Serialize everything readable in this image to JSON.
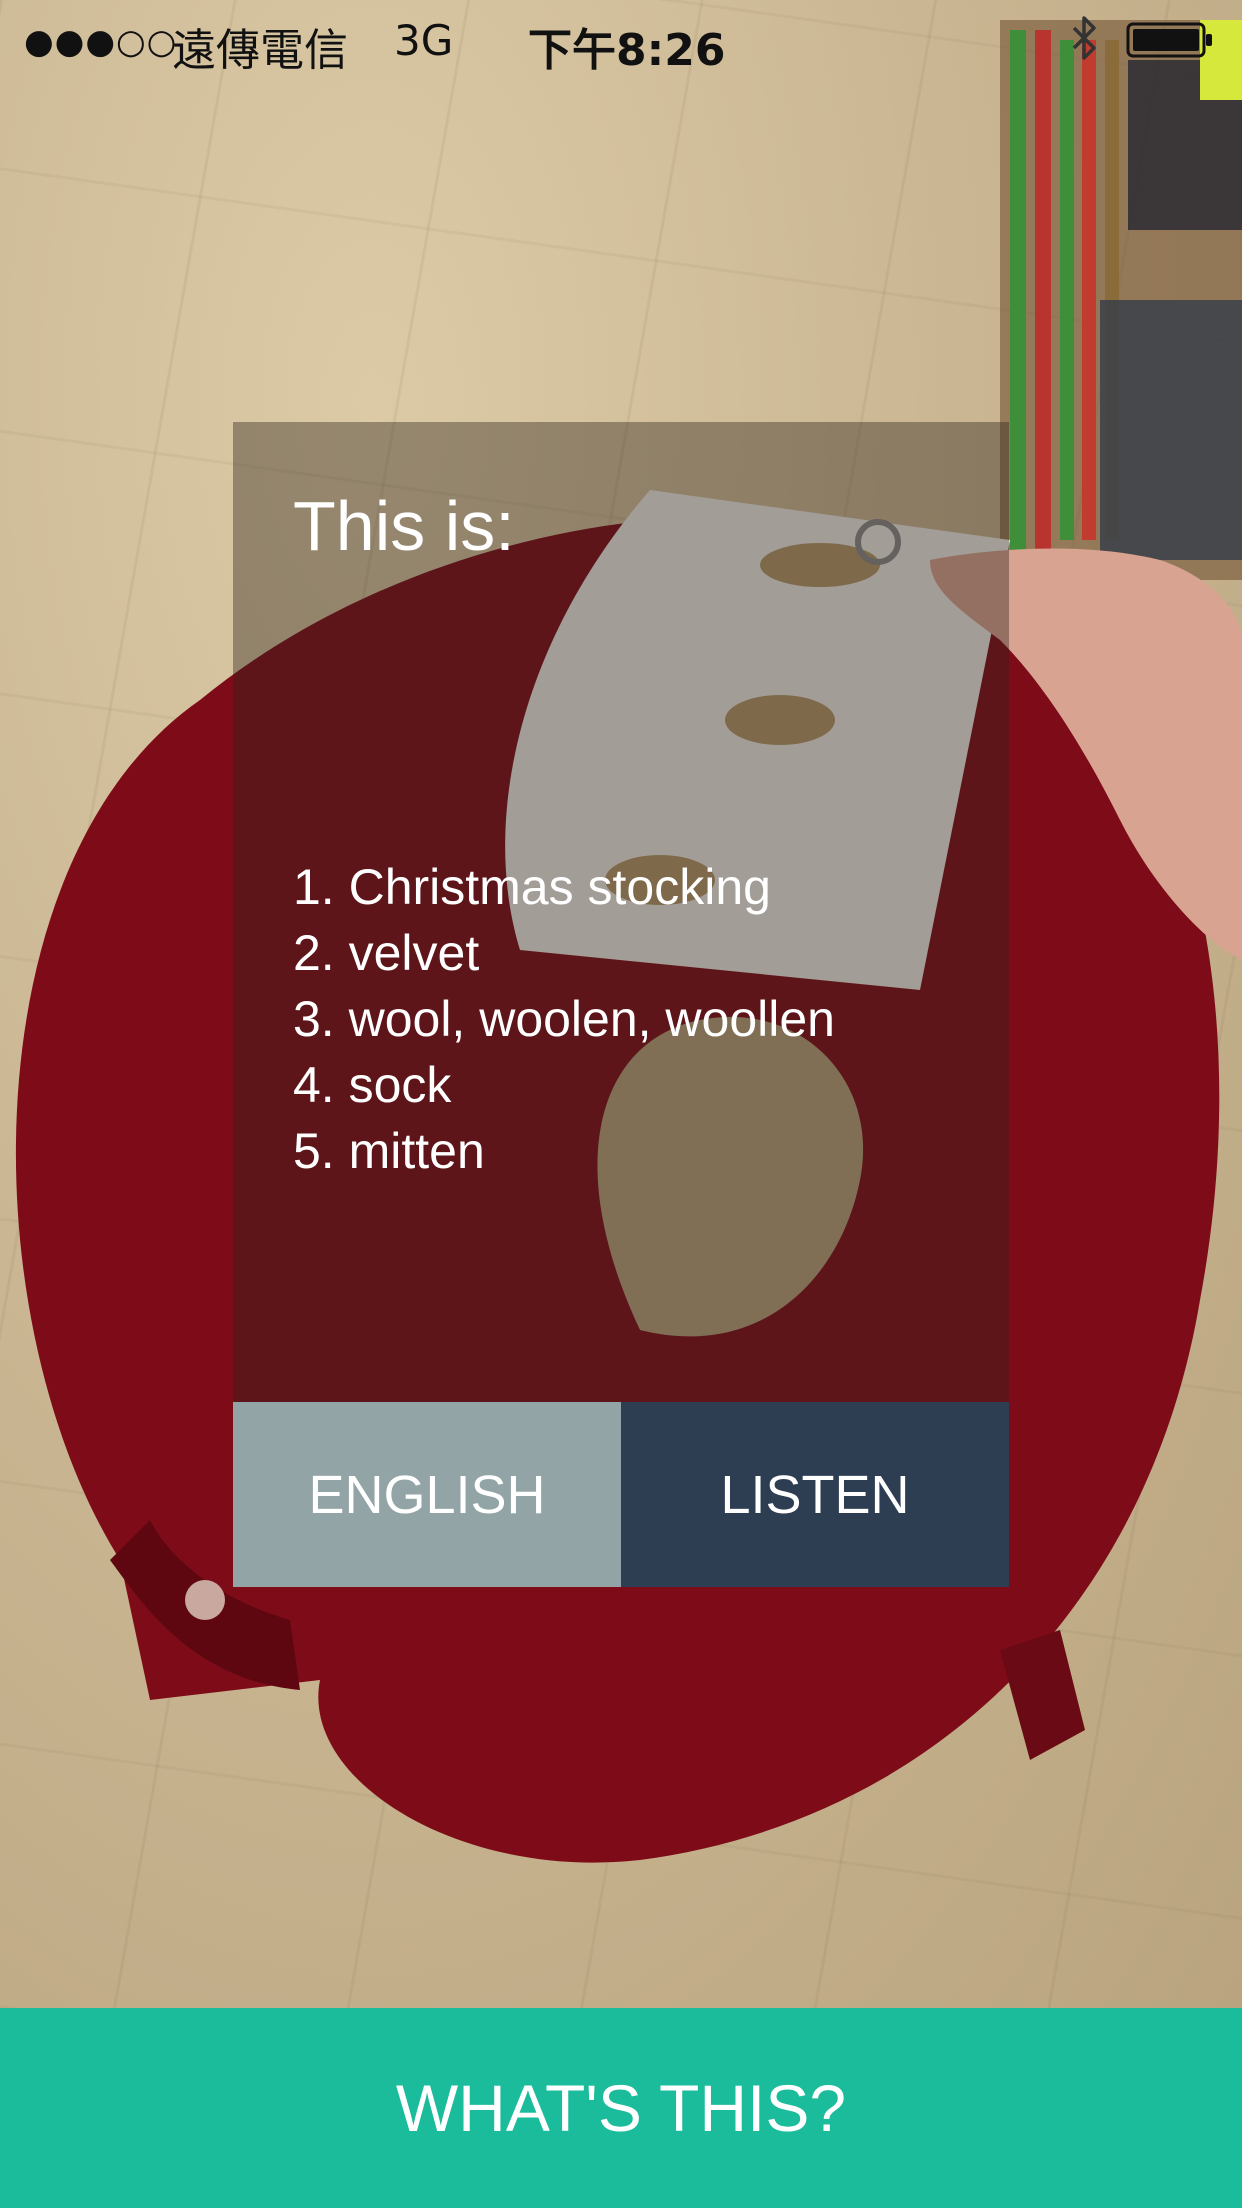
{
  "status_bar": {
    "signal": "●●●○○",
    "carrier": "遠傳電信",
    "network": "3G",
    "time": "下午8:26",
    "bluetooth_icon": "bluetooth-icon",
    "battery_icon": "battery-icon"
  },
  "result": {
    "heading": "This is:",
    "guesses": [
      "1. Christmas stocking",
      "2. velvet",
      "3. wool, woolen, woollen",
      "4. sock",
      "5. mitten"
    ],
    "language_button": "ENGLISH",
    "listen_button": "LISTEN"
  },
  "action": {
    "label": "WHAT'S THIS?"
  },
  "colors": {
    "accent": "#1abc9c",
    "listen_button": "#2d3e52",
    "language_button": "#93a4a6"
  }
}
